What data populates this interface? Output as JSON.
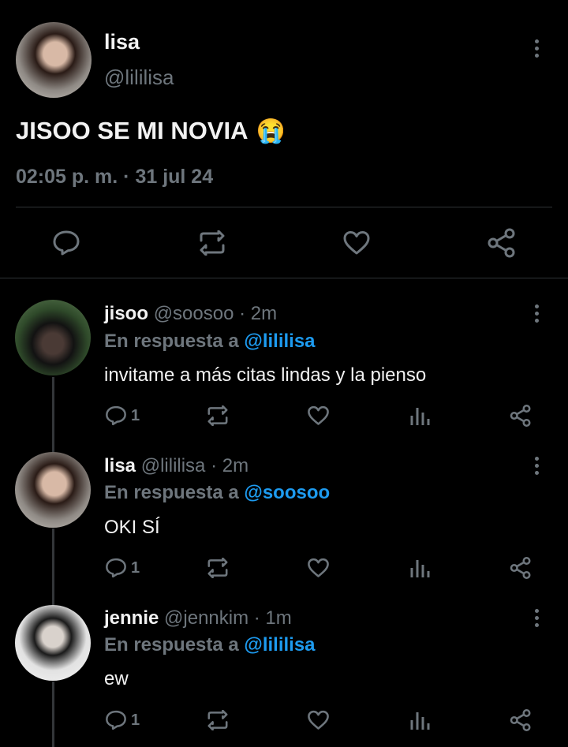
{
  "main_tweet": {
    "author_name": "lisa",
    "author_handle": "@lililisa",
    "text": "JISOO SE MI NOVIA",
    "emoji": "😭",
    "timestamp": "02:05 p. m. · 31 jul 24",
    "actions": [
      "reply-icon",
      "retweet-icon",
      "like-icon",
      "share-icon"
    ]
  },
  "replies": [
    {
      "name": "jisoo",
      "meta": "@soosoo · 2m",
      "replying_to_label": "En respuesta a",
      "replying_to": "@lililisa",
      "text": "invitame a más citas lindas y la pienso",
      "reply_count": "1"
    },
    {
      "name": "lisa",
      "meta": "@lililisa · 2m",
      "replying_to_label": "En respuesta a",
      "replying_to": "@soosoo",
      "text": "OKI SÍ",
      "reply_count": "1"
    },
    {
      "name": "jennie",
      "meta": "@jennkim · 1m",
      "replying_to_label": "En respuesta a",
      "replying_to": "@lililisa",
      "text": "ew",
      "reply_count": "1"
    }
  ],
  "colors": {
    "background": "#000000",
    "text": "#e7e9ea",
    "muted": "#6e767d",
    "mention": "#1d9bf0",
    "divider": "#2f3336"
  }
}
